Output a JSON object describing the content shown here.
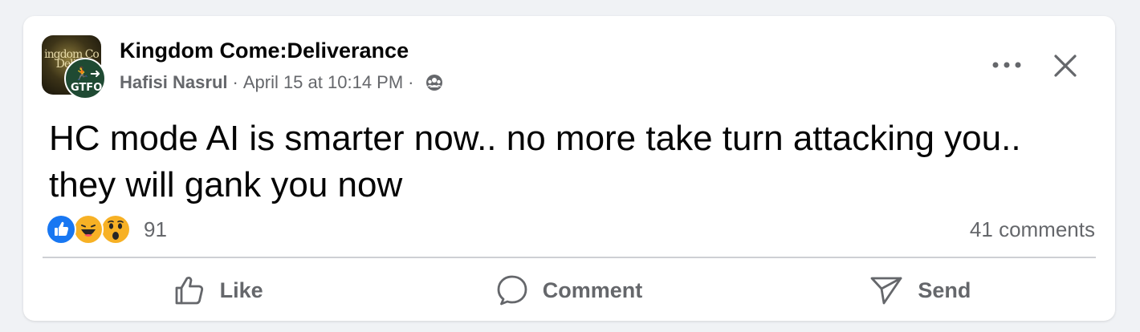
{
  "post": {
    "group_name": "Kingdom Come:Deliverance",
    "author": "Hafisi Nasrul",
    "separator": "·",
    "timestamp": "April 15 at 10:14 PM",
    "text": "HC mode AI is smarter now.. no more take turn attacking you.. they will gank you now",
    "avatar_crest_text": "ingdom Co Delive",
    "badge_text": "GTFO"
  },
  "reactions": {
    "icons": [
      "like-icon",
      "haha-icon",
      "wow-icon"
    ],
    "count": "91"
  },
  "comments": {
    "label": "41 comments"
  },
  "actions": {
    "like_label": "Like",
    "comment_label": "Comment",
    "send_label": "Send"
  },
  "colors": {
    "primary_text": "#050505",
    "secondary_text": "#65676b",
    "like_blue": "#1877f2",
    "emoji_yellow": "#f7b125"
  }
}
